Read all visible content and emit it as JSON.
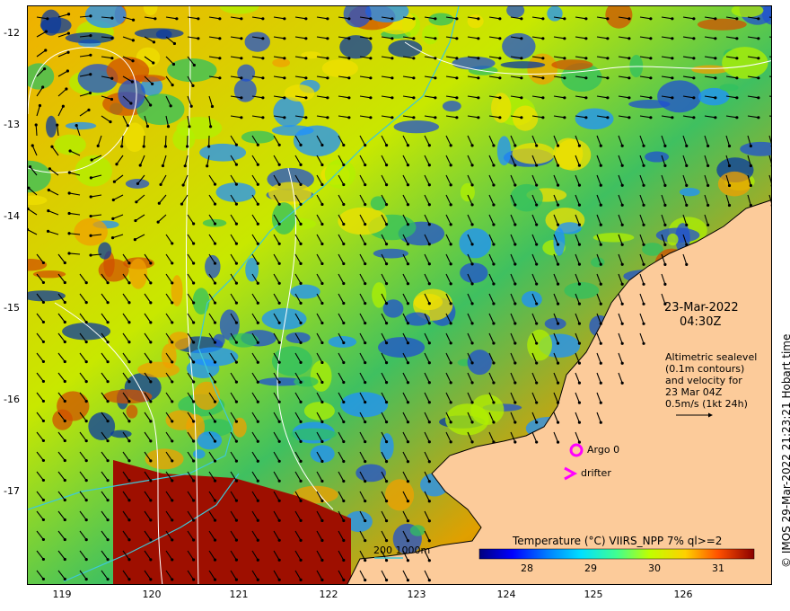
{
  "map": {
    "date": "23-Mar-2022",
    "time": "04:30Z",
    "credit": "© IMOS 29-Mar-2022 21:23:21 Hobart time",
    "latitude_ticks": [
      "-12",
      "-13",
      "-14",
      "-15",
      "-16",
      "-17"
    ],
    "longitude_ticks": [
      "119",
      "120",
      "121",
      "122",
      "123",
      "124",
      "125",
      "126"
    ],
    "info_lines": [
      "Altimetric sealevel",
      "(0.1m contours)",
      "and velocity for",
      "23 Mar 04Z",
      "0.5m/s (1kt 24h)"
    ],
    "argo_label": "Argo 0",
    "drifter_label": "drifter",
    "contour_legend": "200  1000m",
    "colorbar": {
      "title": "Temperature (°C) VIIRS_NPP 7% ql>=2",
      "ticks": [
        "28",
        "29",
        "30",
        "31"
      ]
    },
    "colors": {
      "land": "#fccb9a",
      "coastline": "#000000",
      "ssh_contour": "#ffffff",
      "bathymetry": "#3ec8d8",
      "argo_marker": "#ff00ff",
      "drifter_marker": "#ff00ff"
    }
  }
}
